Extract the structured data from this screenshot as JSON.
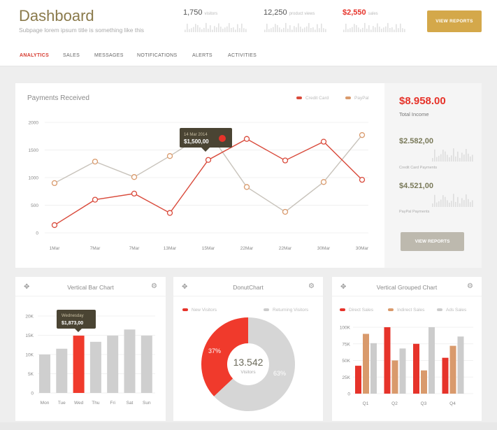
{
  "header": {
    "title": "Dashboard",
    "subtitle": "Subpage lorem ipsum title is something like this",
    "stats": [
      {
        "value": "1,750",
        "label": "visitors"
      },
      {
        "value": "12,250",
        "label": "product views"
      },
      {
        "value": "$2,550",
        "label": "sales"
      }
    ],
    "view_reports": "VIEW REPORTS"
  },
  "tabs": [
    {
      "label": "ANALYTICS",
      "active": true
    },
    {
      "label": "SALES",
      "active": false
    },
    {
      "label": "MESSAGES",
      "active": false
    },
    {
      "label": "NOTIFICATIONS",
      "active": false
    },
    {
      "label": "ALERTS",
      "active": false
    },
    {
      "label": "ACTIVITIES",
      "active": false
    }
  ],
  "payments": {
    "title": "Payments Received",
    "legend": {
      "credit": "Credit Card",
      "paypal": "PayPal"
    },
    "tooltip": {
      "date": "14 Mar 2014",
      "value": "$1,500,00"
    }
  },
  "side": {
    "total_income": "$8.958.00",
    "total_income_label": "Total Income",
    "credit_value": "$2.582,00",
    "credit_label": "Credit Card Payments",
    "paypal_value": "$4.521,00",
    "paypal_label": "PayPal Payments",
    "view_reports": "VIEW REPORTS"
  },
  "widgets": {
    "bar": {
      "title": "Vertical Bar Chart",
      "tooltip_day": "Wednesday",
      "tooltip_value": "$1,873,00"
    },
    "donut": {
      "title": "DonutChart",
      "legend": {
        "new": "New Visitors",
        "returning": "Returning Visitors"
      },
      "center_value": "13.542",
      "center_label": "Visitors",
      "pct_new": "37%",
      "pct_returning": "63%"
    },
    "grouped": {
      "title": "Vertical Grouped Chart",
      "legend": {
        "direct": "Direct Sales",
        "indirect": "Indirect Sales",
        "ads": "Ads Sales"
      }
    }
  },
  "colors": {
    "red": "#e6332a",
    "gold": "#d4a84a",
    "peach": "#d99a6c",
    "grey": "#cccccc",
    "paypal_line": "#c8c3bb"
  },
  "chart_data": [
    {
      "type": "line",
      "title": "Payments Received",
      "x": [
        "1Mar",
        "7Mar",
        "7Mar",
        "13Mar",
        "15Mar",
        "22Mar",
        "22Mar",
        "30Mar",
        "30Mar"
      ],
      "yticks": [
        "0",
        "500",
        "1000",
        "1500",
        "2000"
      ],
      "ylim": [
        0,
        2000
      ],
      "series": [
        {
          "name": "Credit Card",
          "color": "#d94a3b",
          "values": [
            140,
            600,
            710,
            360,
            1320,
            1700,
            1310,
            1650,
            960
          ]
        },
        {
          "name": "PayPal",
          "color": "#c8c3bb",
          "values": [
            900,
            1290,
            1010,
            1390,
            1830,
            830,
            380,
            920,
            1770
          ]
        }
      ],
      "legend": "top-right",
      "grid": true
    },
    {
      "type": "bar",
      "title": "Vertical Bar Chart",
      "categories": [
        "Mon",
        "Tue",
        "Wed",
        "Thu",
        "Fri",
        "Sat",
        "Sun"
      ],
      "values": [
        10000,
        11500,
        14900,
        13300,
        14900,
        16500,
        14900
      ],
      "yticks": [
        "0",
        "5K",
        "10K",
        "15K",
        "20K"
      ],
      "ylim": [
        0,
        20000
      ],
      "highlight": "Wed"
    },
    {
      "type": "pie",
      "title": "DonutChart",
      "labels": [
        "New Visitors",
        "Returning Visitors"
      ],
      "values": [
        37,
        63
      ]
    },
    {
      "type": "bar",
      "title": "Vertical Grouped Chart",
      "categories": [
        "Q1",
        "Q2",
        "Q3",
        "Q4"
      ],
      "yticks": [
        "0",
        "25K",
        "50K",
        "75K",
        "100K"
      ],
      "ylim": [
        0,
        100000
      ],
      "series": [
        {
          "name": "Direct Sales",
          "color": "#e6332a",
          "values": [
            42000,
            100000,
            75000,
            54000
          ]
        },
        {
          "name": "Indirect Sales",
          "color": "#d99a6c",
          "values": [
            90000,
            50000,
            35000,
            72000
          ]
        },
        {
          "name": "Ads Sales",
          "color": "#cccccc",
          "values": [
            76000,
            68000,
            100000,
            86000
          ]
        }
      ]
    }
  ]
}
